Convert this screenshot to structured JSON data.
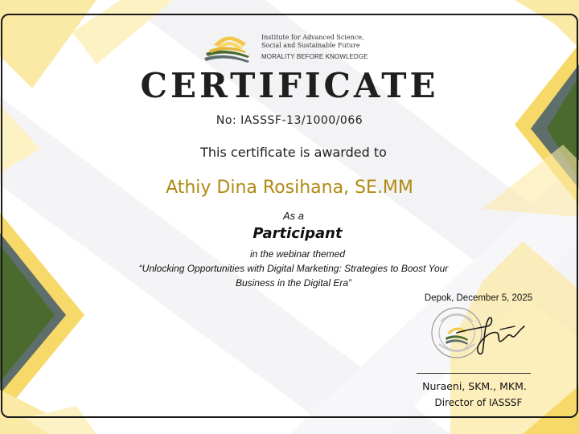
{
  "organization": {
    "name_line1": "Institute for Advanced Science,",
    "name_line2": "Social and Sustainable Future",
    "tagline": "MORALITY BEFORE KNOWLEDGE"
  },
  "certificate": {
    "title": "CERTIFICATE",
    "number": "No: IASSSF-13/1000/066",
    "awarded_text": "This certificate is awarded to",
    "recipient": "Athiy Dina Rosihana, SE.MM",
    "as_a": "As a",
    "role": "Participant",
    "webinar_intro": "in the webinar themed",
    "webinar_title_line1": "“Unlocking Opportunities with Digital Marketing: Strategies to Boost Your",
    "webinar_title_line2": "Business in the Digital Era”"
  },
  "signature_block": {
    "place_date": "Depok, December 5, 2025",
    "signer_name": "Nuraeni, SKM., MKM.",
    "signer_title": "Director of IASSSF",
    "seal_text": "IASSSF"
  },
  "colors": {
    "accent_yellow": "#f7d96a",
    "accent_yellow_light": "#fbe9a6",
    "accent_green": "#4a6b2d",
    "accent_slate": "#5d6e6b",
    "recipient_gold": "#b08a12"
  }
}
